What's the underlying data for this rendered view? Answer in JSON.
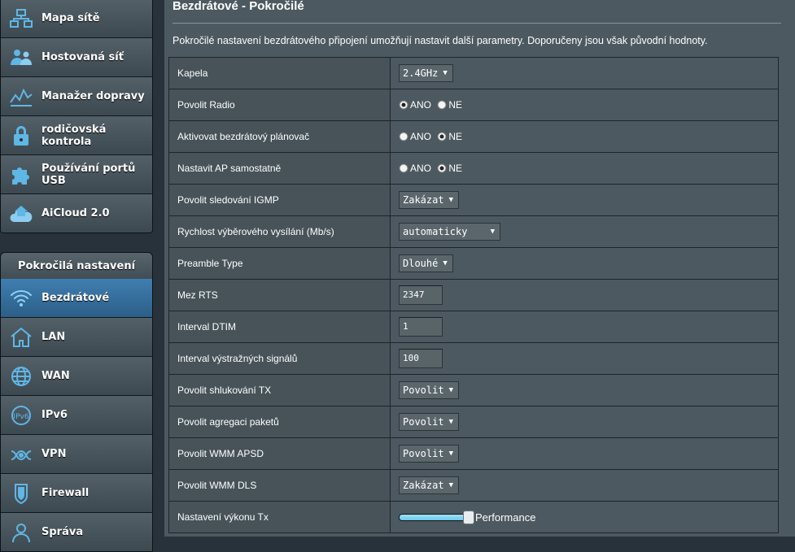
{
  "sidebar": {
    "general": [
      {
        "label": "Mapa sítě",
        "icon": "network-map-icon"
      },
      {
        "label": "Hostovaná síť",
        "icon": "guest-network-icon"
      },
      {
        "label": "Manažer dopravy",
        "icon": "traffic-manager-icon"
      },
      {
        "label": "rodičovská kontrola",
        "icon": "lock-icon"
      },
      {
        "label": "Používání portů USB",
        "icon": "puzzle-icon"
      },
      {
        "label": "AiCloud 2.0",
        "icon": "cloud-house-icon"
      }
    ],
    "advanced_header": "Pokročilá nastavení",
    "advanced": [
      {
        "label": "Bezdrátové",
        "icon": "wifi-icon",
        "active": true
      },
      {
        "label": "LAN",
        "icon": "house-icon"
      },
      {
        "label": "WAN",
        "icon": "globe-icon"
      },
      {
        "label": "IPv6",
        "icon": "ipv6-globe-icon"
      },
      {
        "label": "VPN",
        "icon": "vpn-icon"
      },
      {
        "label": "Firewall",
        "icon": "shield-icon"
      },
      {
        "label": "Správa",
        "icon": "user-icon"
      }
    ]
  },
  "main": {
    "title": "Bezdrátové - Pokročilé",
    "description": "Pokročilé nastavení bezdrátového připojení umožňují nastavit další parametry. Doporučeny jsou však původní hodnoty.",
    "settings": {
      "band": {
        "label": "Kapela",
        "value": "2.4GHz"
      },
      "enable_radio": {
        "label": "Povolit Radio",
        "yes": "ANO",
        "no": "NE",
        "selected": "ANO"
      },
      "scheduler": {
        "label": "Aktivovat bezdrátový plánovač",
        "yes": "ANO",
        "no": "NE",
        "selected": "NE"
      },
      "ap_isolated": {
        "label": "Nastavit AP samostatně",
        "yes": "ANO",
        "no": "NE",
        "selected": "NE"
      },
      "igmp": {
        "label": "Povolit sledování IGMP",
        "value": "Zakázat"
      },
      "multicast_rate": {
        "label": "Rychlost výběrového vysílání (Mb/s)",
        "value": "automaticky"
      },
      "preamble": {
        "label": "Preamble Type",
        "value": "Dlouhé"
      },
      "rts": {
        "label": "Mez RTS",
        "value": "2347"
      },
      "dtim": {
        "label": "Interval DTIM",
        "value": "1"
      },
      "beacon": {
        "label": "Interval výstražných signálů",
        "value": "100"
      },
      "tx_bursting": {
        "label": "Povolit shlukování TX",
        "value": "Povolit"
      },
      "aggregation": {
        "label": "Povolit agregaci paketů",
        "value": "Povolit"
      },
      "wmm_apsd": {
        "label": "Povolit WMM APSD",
        "value": "Povolit"
      },
      "wmm_dls": {
        "label": "Povolit WMM DLS",
        "value": "Zakázat"
      },
      "tx_power": {
        "label": "Nastavení výkonu Tx",
        "value_label": "Performance",
        "level": 1.0
      }
    }
  },
  "colors": {
    "accent": "#3f7eb0",
    "slider": "#8ad8f5"
  }
}
